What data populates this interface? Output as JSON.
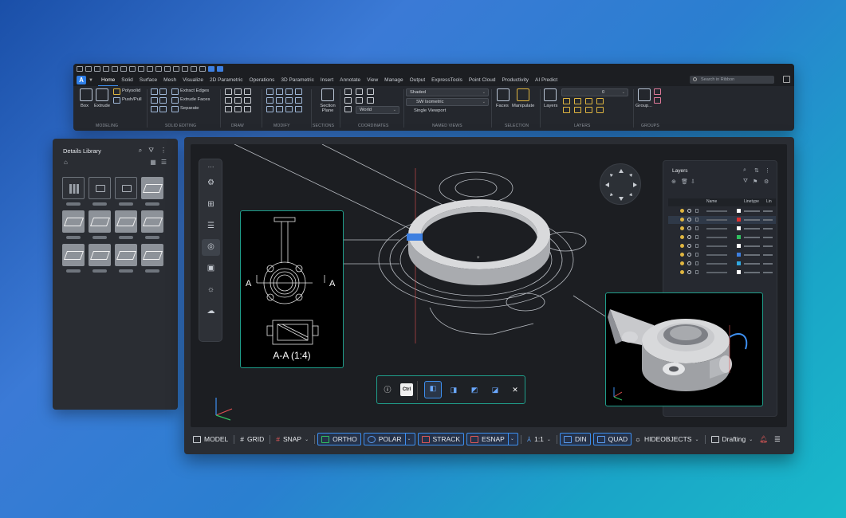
{
  "ribbon": {
    "tabs": [
      "Home",
      "Solid",
      "Surface",
      "Mesh",
      "Visualize",
      "2D Parametric",
      "Operations",
      "3D Parametric",
      "Insert",
      "Annotate",
      "View",
      "Manage",
      "Output",
      "ExpressTools",
      "Point Cloud",
      "Productivity",
      "AI Predict"
    ],
    "active_tab": "Home",
    "search_placeholder": "Search in Ribbon",
    "modeling": {
      "box": "Box",
      "extrude": "Extrude",
      "polysolid": "Polysolid",
      "pushpull": "Push/Pull",
      "label": "MODELING"
    },
    "solid_editing": {
      "extract_edges": "Extract Edges",
      "extrude_faces": "Extrude Faces",
      "separate": "Separate",
      "label": "SOLID EDITING"
    },
    "draw_label": "DRAW",
    "modify_label": "MODIFY",
    "sections": {
      "section_plane": "Section Plane",
      "label": "SECTIONS"
    },
    "coordinates": {
      "world": "World",
      "label": "COORDINATES"
    },
    "named_views": {
      "visual_style": "Shaded",
      "view": "SW Isometric",
      "viewport": "Single Viewport",
      "label": "NAMED VIEWS"
    },
    "selection": {
      "faces": "Faces",
      "manipulate": "Manipulate",
      "label": "SELECTION"
    },
    "layers": {
      "layers": "Layers",
      "current": "0",
      "label": "LAYERS"
    },
    "groups": {
      "group": "Group...",
      "label": "GROUPS"
    }
  },
  "details_library": {
    "title": "Details Library"
  },
  "viewport": {
    "section_caption": "A-A (1:4)",
    "section_marker": "A",
    "quick_bar": {
      "ctrl": "Ctrl"
    }
  },
  "layers_panel": {
    "title": "Layers",
    "col_name": "Name",
    "col_linetype": "Linetype",
    "col_extra": "Lin",
    "row_colors": [
      "#ffffff",
      "#e03030",
      "#ffffff",
      "#30c060",
      "#ffffff",
      "#3d7fe0",
      "#30a8e0",
      "#ffffff"
    ]
  },
  "statusbar": {
    "model": "MODEL",
    "grid": "GRID",
    "snap": "SNAP",
    "ortho": "ORTHO",
    "polar": "POLAR",
    "strack": "STRACK",
    "esnap": "ESNAP",
    "scale": "1:1",
    "din": "DIN",
    "quad": "QUAD",
    "hideobjects": "HIDEOBJECTS",
    "workspace": "Drafting"
  }
}
